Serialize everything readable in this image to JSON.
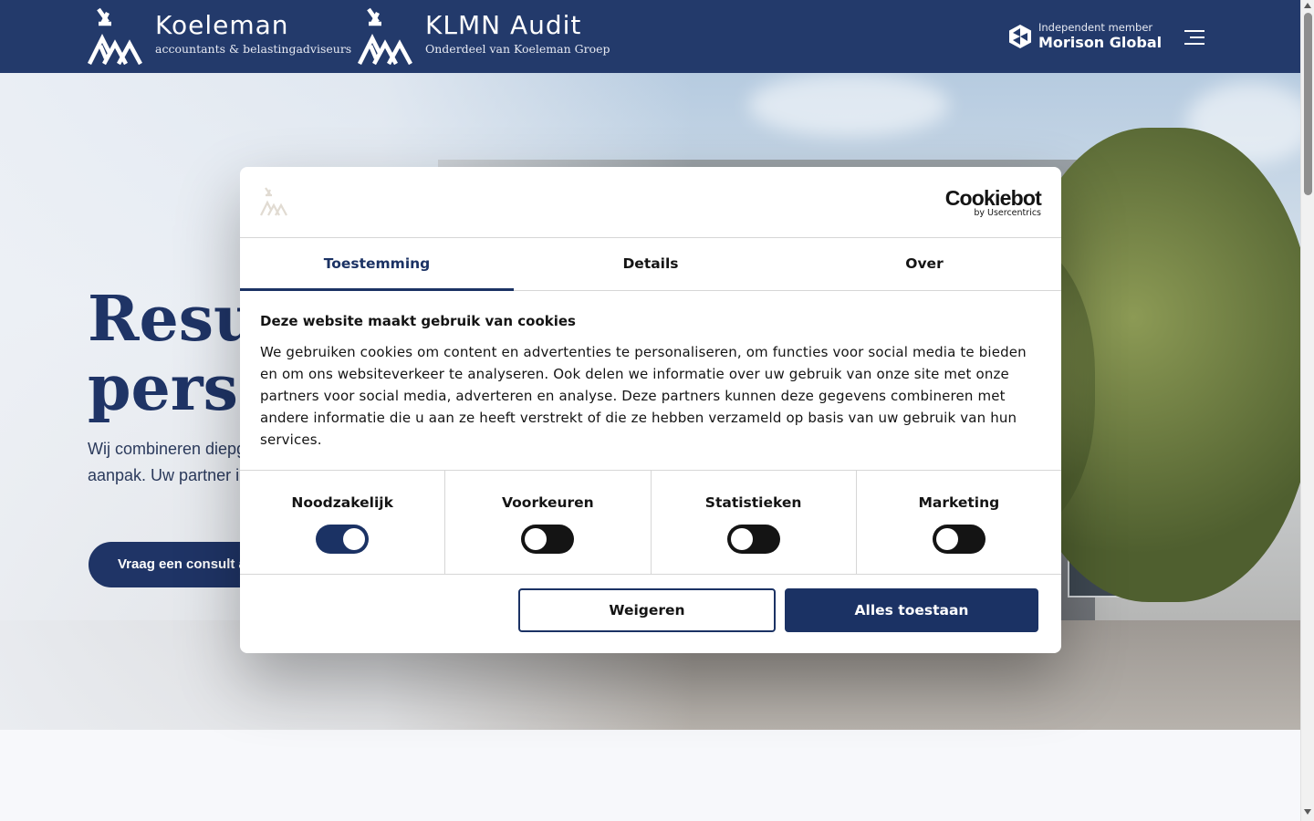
{
  "header": {
    "brand1": {
      "name": "Koeleman",
      "sub": "accountants & belastingadviseurs"
    },
    "brand2": {
      "name": "KLMN Audit",
      "sub": "Onderdeel van Koeleman Groep"
    },
    "member": {
      "small": "Independent member",
      "big": "Morison Global"
    },
    "menu_icon": "hamburger-icon"
  },
  "hero": {
    "title_line1": "Result",
    "title_line2": "perso",
    "text_line1": "Wij combineren diepg",
    "text_line2": "aanpak. Uw partner in",
    "cta": "Vraag een consult a"
  },
  "dialog": {
    "brand": {
      "line1": "Cookiebot",
      "line2": "by Usercentrics"
    },
    "tabs": [
      {
        "label": "Toestemming",
        "active": true
      },
      {
        "label": "Details",
        "active": false
      },
      {
        "label": "Over",
        "active": false
      }
    ],
    "heading": "Deze website maakt gebruik van cookies",
    "body": "We gebruiken cookies om content en advertenties te personaliseren, om functies voor social media te bieden en om ons websiteverkeer te analyseren. Ook delen we informatie over uw gebruik van onze site met onze partners voor social media, adverteren en analyse. Deze partners kunnen deze gegevens combineren met andere informatie die u aan ze heeft verstrekt of die ze hebben verzameld op basis van uw gebruik van hun services.",
    "toggles": [
      {
        "label": "Noodzakelijk",
        "on": true
      },
      {
        "label": "Voorkeuren",
        "on": false
      },
      {
        "label": "Statistieken",
        "on": false
      },
      {
        "label": "Marketing",
        "on": false
      }
    ],
    "decline": "Weigeren",
    "accept": "Alles toestaan"
  },
  "colors": {
    "brand_navy": "#233a6b",
    "button_navy": "#1b3264"
  }
}
